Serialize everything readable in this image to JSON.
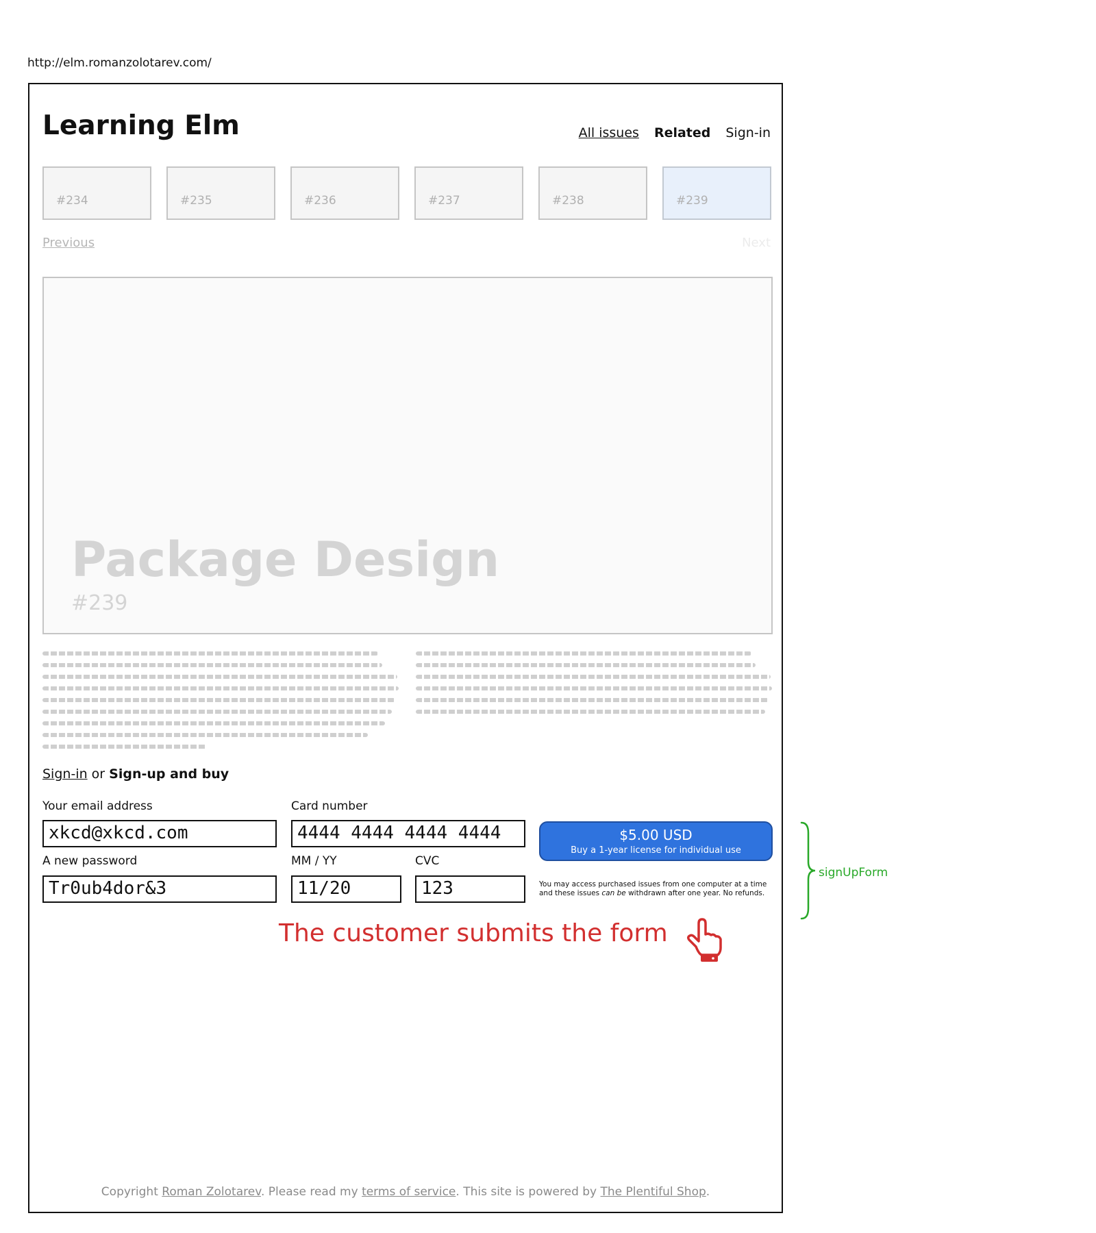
{
  "browser": {
    "url": "http://elm.romanzolotarev.com/"
  },
  "header": {
    "title": "Learning Elm",
    "nav": {
      "all_issues": "All issues",
      "related": "Related",
      "signin": "Sign-in"
    }
  },
  "issues": [
    "#234",
    "#235",
    "#236",
    "#237",
    "#238",
    "#239"
  ],
  "pager": {
    "previous": "Previous",
    "next": "Next"
  },
  "hero": {
    "title": "Package Design",
    "number": "#239"
  },
  "auth": {
    "signin": "Sign-in",
    "or": "or",
    "signup": "Sign-up and buy"
  },
  "form": {
    "email_label": "Your email address",
    "email_value": "xkcd@xkcd.com",
    "password_label": "A new password",
    "password_value": "Tr0ub4dor&3",
    "card_label": "Card number",
    "card_value": "4444 4444 4444 4444",
    "expiry_label": "MM / YY",
    "expiry_value": "11/20",
    "cvc_label": "CVC",
    "cvc_value": "123"
  },
  "buy": {
    "price": "$5.00 USD",
    "subtitle": "Buy a 1-year license for individual use"
  },
  "disclaimer": {
    "part1": "You may access purchased issues from one computer at a time and these issues",
    "emph": "can be",
    "part2": "withdrawn after one year. No refunds."
  },
  "annotation": {
    "text": "The customer submits the form",
    "brace_label": "signUpForm"
  },
  "footer": {
    "t1": "Copyright ",
    "author": "Roman Zolotarev",
    "t2": ". Please read my ",
    "terms": "terms of service",
    "t3": ". This site is powered by ",
    "shop": "The Plentiful Shop",
    "t4": "."
  },
  "colors": {
    "button": "#2f73de",
    "annotation": "#d22f2f",
    "brace": "#28a828",
    "active_issue": "#e8f0fb"
  }
}
